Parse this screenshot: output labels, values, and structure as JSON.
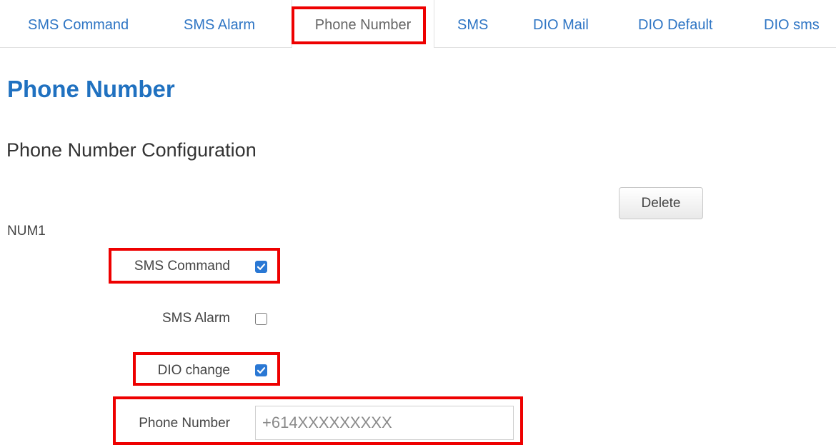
{
  "tabs": [
    {
      "label": "SMS Command"
    },
    {
      "label": "SMS Alarm"
    },
    {
      "label": "Phone Number",
      "active": true
    },
    {
      "label": "SMS"
    },
    {
      "label": "DIO Mail"
    },
    {
      "label": "DIO Default"
    },
    {
      "label": "DIO sms"
    }
  ],
  "page": {
    "title": "Phone Number",
    "section_title": "Phone Number Configuration"
  },
  "entry": {
    "name": "NUM1",
    "delete_label": "Delete",
    "sms_command": {
      "label": "SMS Command",
      "checked": true
    },
    "sms_alarm": {
      "label": "SMS Alarm",
      "checked": false
    },
    "dio_change": {
      "label": "DIO change",
      "checked": true
    },
    "phone_number": {
      "label": "Phone Number",
      "placeholder": "+614XXXXXXXXX",
      "value": ""
    }
  },
  "colors": {
    "tab_link": "#2e75c4",
    "title": "#2071c0",
    "checkbox_checked": "#2a78d4",
    "highlight": "#ee0000"
  }
}
